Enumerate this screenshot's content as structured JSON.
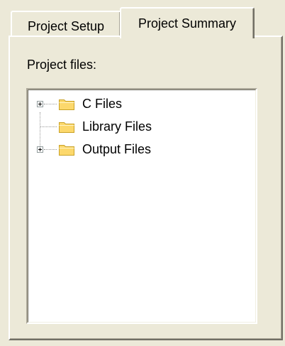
{
  "tabs": [
    {
      "label": "Project Setup",
      "selected": false
    },
    {
      "label": "Project Summary",
      "selected": true
    }
  ],
  "summary": {
    "files_label": "Project files:"
  },
  "tree": {
    "nodes": [
      {
        "label": "C Files",
        "expandable": true,
        "icon": "folder-icon"
      },
      {
        "label": "Library Files",
        "expandable": false,
        "icon": "folder-icon"
      },
      {
        "label": "Output Files",
        "expandable": true,
        "icon": "folder-icon"
      }
    ]
  },
  "colors": {
    "dialog_background": "#ece9d8",
    "tree_background": "#ffffff",
    "folder_fill": "#fcd86c",
    "folder_outline": "#c9a227"
  }
}
